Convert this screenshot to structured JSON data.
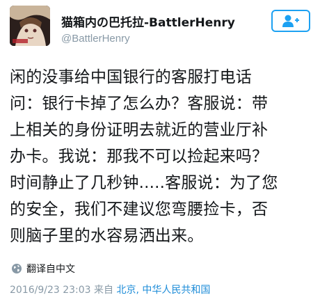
{
  "user": {
    "display_name": "猫箱内の巴托拉-BattlerHenry",
    "handle": "@BattlerHenry"
  },
  "follow_button": {
    "icon": "add-user-icon",
    "color": "#1da1f2"
  },
  "tweet": {
    "lines": [
      "闲的没事给中国银行的客服打电话",
      "问：银行卡掉了怎么办？客服说：带",
      "上相关的身份证明去就近的营业厅补",
      "办卡。我说：那我不可以捡起来吗？",
      "时间静止了几秒钟.....客服说：为了您",
      "的安全，我们不建议您弯腰捡卡，否",
      "则脑子里的水容易洒出来。"
    ]
  },
  "translate": {
    "label": "翻译自中文",
    "icon": "globe-icon"
  },
  "meta": {
    "timestamp": "2016/9/23 23:03",
    "from_label": "来自",
    "location": "北京, 中华人民共和国"
  },
  "colors": {
    "link": "#1d8cd8",
    "muted": "#8899a6",
    "text": "#14171a"
  }
}
